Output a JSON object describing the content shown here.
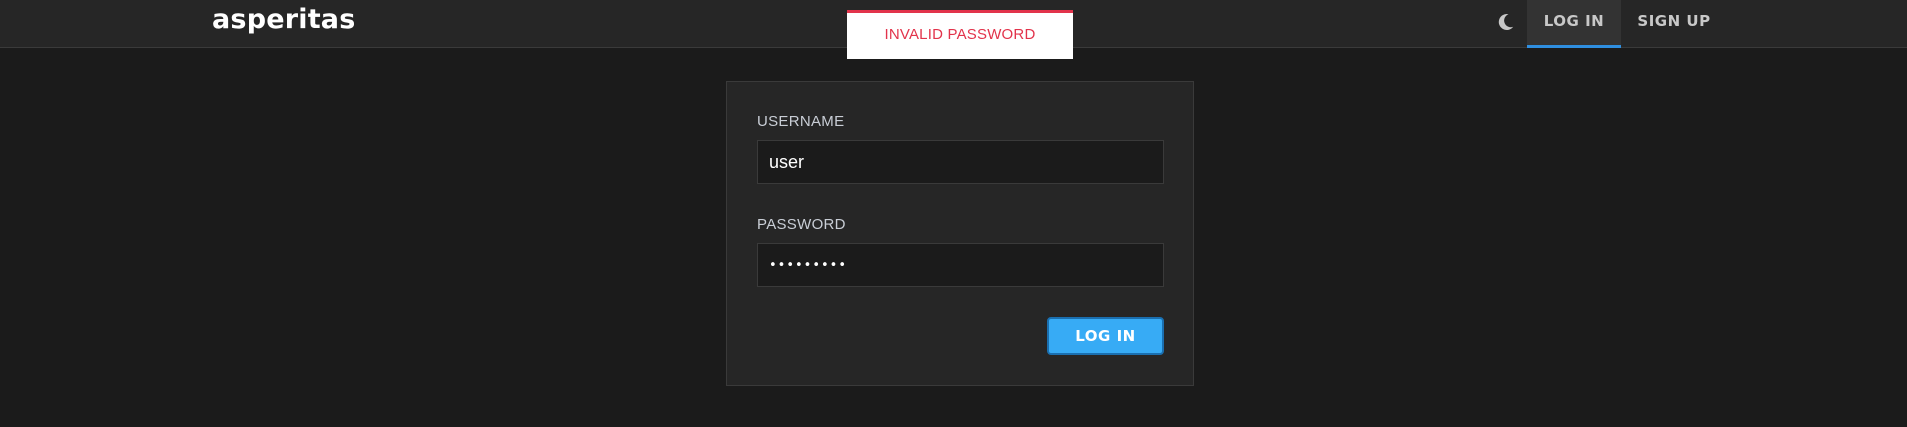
{
  "header": {
    "brand": "asperitas",
    "theme_toggle_icon": "moon-icon",
    "nav": [
      {
        "label": "LOG IN",
        "active": true
      },
      {
        "label": "SIGN UP",
        "active": false
      }
    ]
  },
  "toast": {
    "message": "INVALID PASSWORD",
    "color": "#e2334b"
  },
  "form": {
    "username": {
      "label": "USERNAME",
      "value": "user"
    },
    "password": {
      "label": "PASSWORD",
      "value": "•••••••••"
    },
    "submit_label": "LOG IN"
  },
  "colors": {
    "background": "#1b1b1b",
    "surface": "#262626",
    "accent": "#37abf5",
    "active_tab_underline": "#2f8fe0"
  }
}
